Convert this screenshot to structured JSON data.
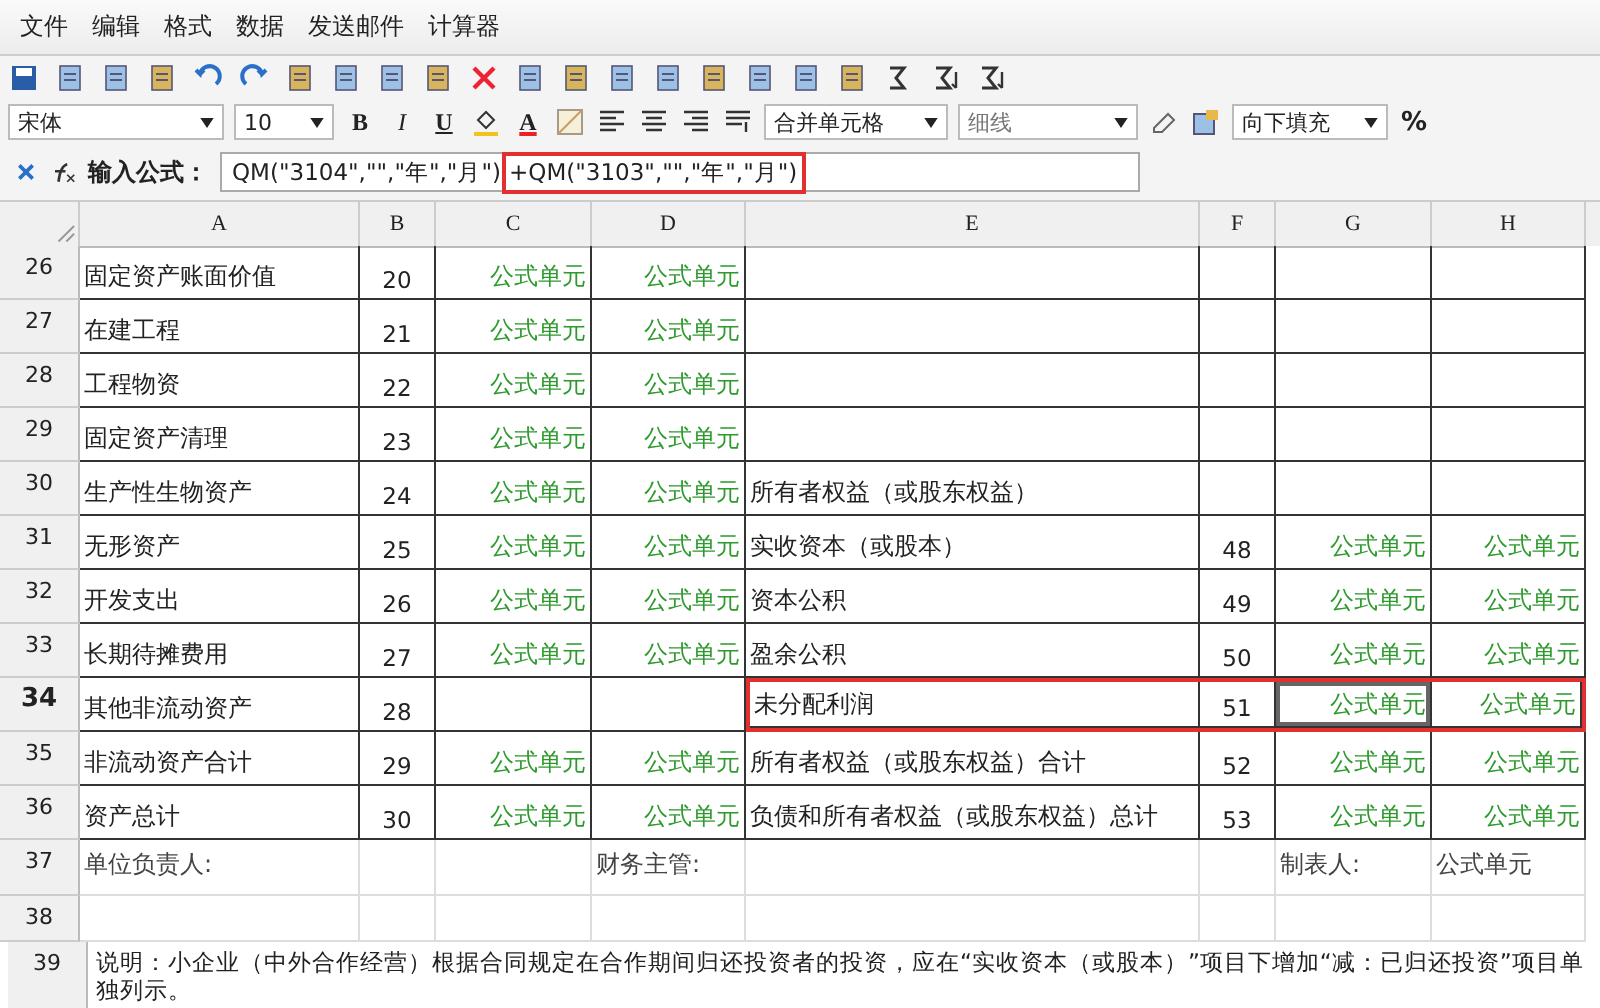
{
  "menu": [
    "文件",
    "编辑",
    "格式",
    "数据",
    "发送邮件",
    "计算器"
  ],
  "toolbar": {
    "font": "宋体",
    "size": "10",
    "bold": "B",
    "italic": "I",
    "underline": "U",
    "font_color": "A",
    "merge": "合并单元格",
    "border_style": "细线",
    "fill": "向下填充",
    "percent": "%"
  },
  "formula_bar": {
    "label": "输入公式：",
    "parts": [
      {
        "text": "QM(\"3104\",\"\",\"年\",\"月\")",
        "highlighted": false
      },
      {
        "text": "+QM(\"3103\",\"\",\"年\",\"月\")",
        "highlighted": true
      }
    ]
  },
  "columns": [
    "A",
    "B",
    "C",
    "D",
    "E",
    "F",
    "G",
    "H"
  ],
  "rows": [
    {
      "number": "26",
      "kind": "grid",
      "selected": false,
      "highlighted": false,
      "cells": [
        {
          "text": "固定资产账面价值",
          "kind": "text"
        },
        {
          "text": "20",
          "kind": "number"
        },
        {
          "text": "公式单元",
          "kind": "formula"
        },
        {
          "text": "公式单元",
          "kind": "formula"
        },
        null,
        null,
        null,
        null
      ]
    },
    {
      "number": "27",
      "kind": "grid",
      "selected": false,
      "highlighted": false,
      "cells": [
        {
          "text": "在建工程",
          "kind": "text"
        },
        {
          "text": "21",
          "kind": "number"
        },
        {
          "text": "公式单元",
          "kind": "formula"
        },
        {
          "text": "公式单元",
          "kind": "formula"
        },
        null,
        null,
        null,
        null
      ]
    },
    {
      "number": "28",
      "kind": "grid",
      "selected": false,
      "highlighted": false,
      "cells": [
        {
          "text": "工程物资",
          "kind": "text"
        },
        {
          "text": "22",
          "kind": "number"
        },
        {
          "text": "公式单元",
          "kind": "formula"
        },
        {
          "text": "公式单元",
          "kind": "formula"
        },
        null,
        null,
        null,
        null
      ]
    },
    {
      "number": "29",
      "kind": "grid",
      "selected": false,
      "highlighted": false,
      "cells": [
        {
          "text": "固定资产清理",
          "kind": "text"
        },
        {
          "text": "23",
          "kind": "number"
        },
        {
          "text": "公式单元",
          "kind": "formula"
        },
        {
          "text": "公式单元",
          "kind": "formula"
        },
        null,
        null,
        null,
        null
      ]
    },
    {
      "number": "30",
      "kind": "grid",
      "selected": false,
      "highlighted": false,
      "cells": [
        {
          "text": "生产性生物资产",
          "kind": "text"
        },
        {
          "text": "24",
          "kind": "number"
        },
        {
          "text": "公式单元",
          "kind": "formula"
        },
        {
          "text": "公式单元",
          "kind": "formula"
        },
        {
          "text": "所有者权益（或股东权益）",
          "kind": "text"
        },
        null,
        null,
        null
      ]
    },
    {
      "number": "31",
      "kind": "grid",
      "selected": false,
      "highlighted": false,
      "cells": [
        {
          "text": "无形资产",
          "kind": "text"
        },
        {
          "text": "25",
          "kind": "number"
        },
        {
          "text": "公式单元",
          "kind": "formula"
        },
        {
          "text": "公式单元",
          "kind": "formula"
        },
        {
          "text": "实收资本（或股本）",
          "kind": "text"
        },
        {
          "text": "48",
          "kind": "number"
        },
        {
          "text": "公式单元",
          "kind": "formula"
        },
        {
          "text": "公式单元",
          "kind": "formula"
        }
      ]
    },
    {
      "number": "32",
      "kind": "grid",
      "selected": false,
      "highlighted": false,
      "cells": [
        {
          "text": "开发支出",
          "kind": "text"
        },
        {
          "text": "26",
          "kind": "number"
        },
        {
          "text": "公式单元",
          "kind": "formula"
        },
        {
          "text": "公式单元",
          "kind": "formula"
        },
        {
          "text": "资本公积",
          "kind": "text"
        },
        {
          "text": "49",
          "kind": "number"
        },
        {
          "text": "公式单元",
          "kind": "formula"
        },
        {
          "text": "公式单元",
          "kind": "formula"
        }
      ]
    },
    {
      "number": "33",
      "kind": "grid",
      "selected": false,
      "highlighted": false,
      "cells": [
        {
          "text": "长期待摊费用",
          "kind": "text"
        },
        {
          "text": "27",
          "kind": "number"
        },
        {
          "text": "公式单元",
          "kind": "formula"
        },
        {
          "text": "公式单元",
          "kind": "formula"
        },
        {
          "text": "盈余公积",
          "kind": "text"
        },
        {
          "text": "50",
          "kind": "number"
        },
        {
          "text": "公式单元",
          "kind": "formula"
        },
        {
          "text": "公式单元",
          "kind": "formula"
        }
      ]
    },
    {
      "number": "34",
      "kind": "grid",
      "selected": true,
      "highlighted": true,
      "cells": [
        {
          "text": "其他非流动资产",
          "kind": "text"
        },
        {
          "text": "28",
          "kind": "number"
        },
        null,
        null,
        {
          "text": "未分配利润",
          "kind": "text"
        },
        {
          "text": "51",
          "kind": "number"
        },
        {
          "text": "公式单元",
          "kind": "formula",
          "active": true
        },
        {
          "text": "公式单元",
          "kind": "formula"
        }
      ]
    },
    {
      "number": "35",
      "kind": "grid",
      "selected": false,
      "highlighted": false,
      "cells": [
        {
          "text": "非流动资产合计",
          "kind": "text"
        },
        {
          "text": "29",
          "kind": "number"
        },
        {
          "text": "公式单元",
          "kind": "formula"
        },
        {
          "text": "公式单元",
          "kind": "formula"
        },
        {
          "text": "所有者权益（或股东权益）合计",
          "kind": "text"
        },
        {
          "text": "52",
          "kind": "number"
        },
        {
          "text": "公式单元",
          "kind": "formula"
        },
        {
          "text": "公式单元",
          "kind": "formula"
        }
      ]
    },
    {
      "number": "36",
      "kind": "grid",
      "selected": false,
      "highlighted": false,
      "cells": [
        {
          "text": "资产总计",
          "kind": "text"
        },
        {
          "text": "30",
          "kind": "number"
        },
        {
          "text": "公式单元",
          "kind": "formula"
        },
        {
          "text": "公式单元",
          "kind": "formula"
        },
        {
          "text": "负债和所有者权益（或股东权益）总计",
          "kind": "text"
        },
        {
          "text": "53",
          "kind": "number"
        },
        {
          "text": "公式单元",
          "kind": "formula"
        },
        {
          "text": "公式单元",
          "kind": "formula"
        }
      ]
    },
    {
      "number": "37",
      "kind": "footer",
      "selected": false,
      "highlighted": false,
      "cells": [
        {
          "text": "单位负责人:",
          "kind": "text"
        },
        null,
        null,
        {
          "text": "财务主管:",
          "kind": "text"
        },
        null,
        null,
        {
          "text": "制表人:",
          "kind": "text"
        },
        {
          "text": "公式单元",
          "kind": "formula_left"
        }
      ]
    },
    {
      "number": "38",
      "kind": "footer",
      "selected": false,
      "highlighted": false,
      "cells": [
        null,
        null,
        null,
        null,
        null,
        null,
        null,
        null
      ]
    },
    {
      "number": "39",
      "kind": "note",
      "selected": false,
      "highlighted": false,
      "note": "说明：小企业（中外合作经营）根据合同规定在合作期间归还投资者的投资，应在“实收资本（或股本）”项目下增加“减：已归还投资”项目单独列示。"
    }
  ]
}
